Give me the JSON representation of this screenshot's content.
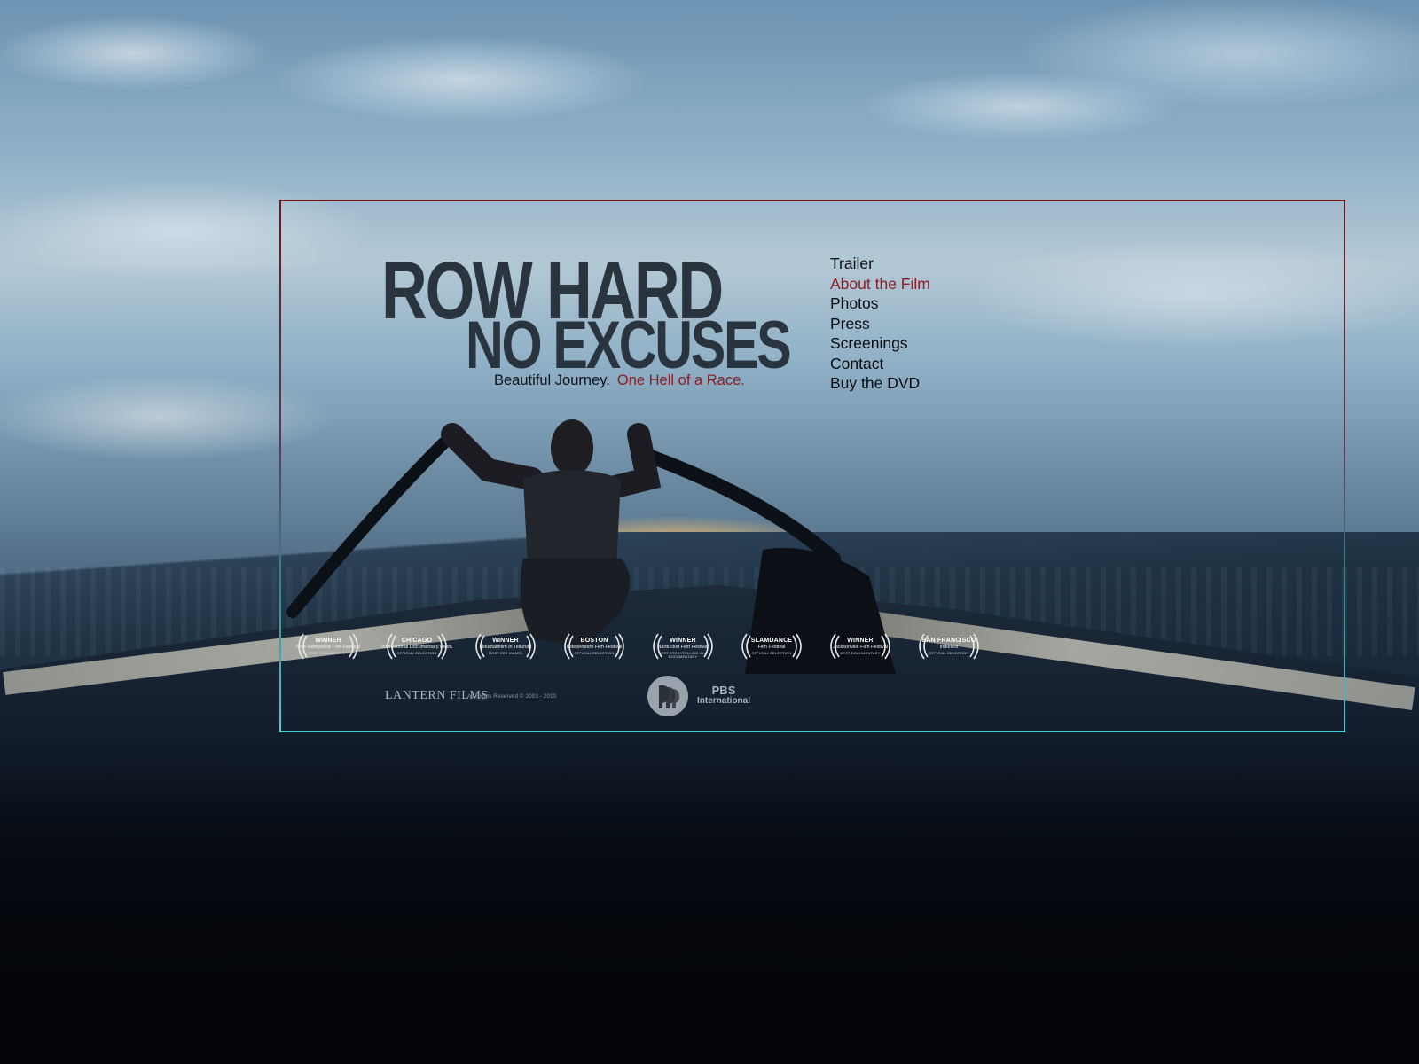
{
  "title": {
    "line1": "ROW HARD",
    "line2": "NO EXCUSES"
  },
  "tagline": {
    "main": "Beautiful Journey.",
    "accent": "One Hell of a Race."
  },
  "nav": {
    "items": [
      {
        "label": "Trailer",
        "active": false
      },
      {
        "label": "About the Film",
        "active": true
      },
      {
        "label": "Photos",
        "active": false
      },
      {
        "label": "Press",
        "active": false
      },
      {
        "label": "Screenings",
        "active": false
      },
      {
        "label": "Contact",
        "active": false
      },
      {
        "label": "Buy the DVD",
        "active": false
      }
    ]
  },
  "laurels": [
    {
      "title": "WINNER",
      "subtitle": "New Hampshire Film Festival",
      "note": "BEST DOCUMENTARY"
    },
    {
      "title": "CHICAGO",
      "subtitle": "International Documentary Festival",
      "note": "OFFICIAL SELECTION"
    },
    {
      "title": "WINNER",
      "subtitle": "Mountainfilm in Telluride",
      "note": "MOST-SEE AWARD"
    },
    {
      "title": "BOSTON",
      "subtitle": "Independent Film Festival",
      "note": "OFFICIAL SELECTION"
    },
    {
      "title": "WINNER",
      "subtitle": "Nantucket Film Festival",
      "note": "BEST STORYTELLING IN A DOCUMENTARY"
    },
    {
      "title": "SLAMDANCE",
      "subtitle": "Film Festival",
      "note": "OFFICIAL SELECTION"
    },
    {
      "title": "WINNER",
      "subtitle": "Jacksonville Film Festival",
      "note": "BEST DOCUMENTARY"
    },
    {
      "title": "SAN FRANCISCO",
      "subtitle": "Indiefest",
      "note": "OFFICIAL SELECTION"
    }
  ],
  "footer": {
    "studio": "LANTERN FILMS",
    "rights": "All Rights Reserved © 2003 - 2010",
    "pbs": "PBS",
    "pbs_sub": "International"
  },
  "colors": {
    "accent": "#8c1d22",
    "title": "#2a343f",
    "frame_top": "#6e1620",
    "frame_bottom": "#52c8cf"
  }
}
